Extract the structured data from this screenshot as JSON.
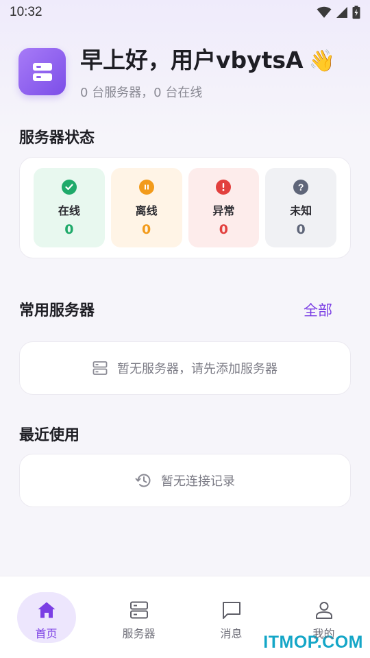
{
  "status_bar": {
    "time": "10:32"
  },
  "header": {
    "greeting": "早上好，用户vbytsA",
    "wave": "👋",
    "subtitle": "0 台服务器，0 台在线"
  },
  "server_status": {
    "title": "服务器状态",
    "items": [
      {
        "label": "在线",
        "value": "0",
        "color": "#1faa6a",
        "bg": "#e8f8ef"
      },
      {
        "label": "离线",
        "value": "0",
        "color": "#f29b1b",
        "bg": "#fff4e6"
      },
      {
        "label": "异常",
        "value": "0",
        "color": "#e2403e",
        "bg": "#fdeceb"
      },
      {
        "label": "未知",
        "value": "0",
        "color": "#5f6679",
        "bg": "#f0f1f4"
      }
    ]
  },
  "favorites": {
    "title": "常用服务器",
    "all_link": "全部",
    "empty_text": "暂无服务器，请先添加服务器"
  },
  "recent": {
    "title": "最近使用",
    "empty_text": "暂无连接记录"
  },
  "bottom_nav": {
    "items": [
      {
        "label": "首页",
        "icon": "home-icon",
        "active": true
      },
      {
        "label": "服务器",
        "icon": "server-icon",
        "active": false
      },
      {
        "label": "消息",
        "icon": "message-icon",
        "active": false
      },
      {
        "label": "我的",
        "icon": "user-icon",
        "active": false
      }
    ]
  },
  "watermark": "ITMOP.COM",
  "colors": {
    "accent": "#7b3fe4"
  }
}
